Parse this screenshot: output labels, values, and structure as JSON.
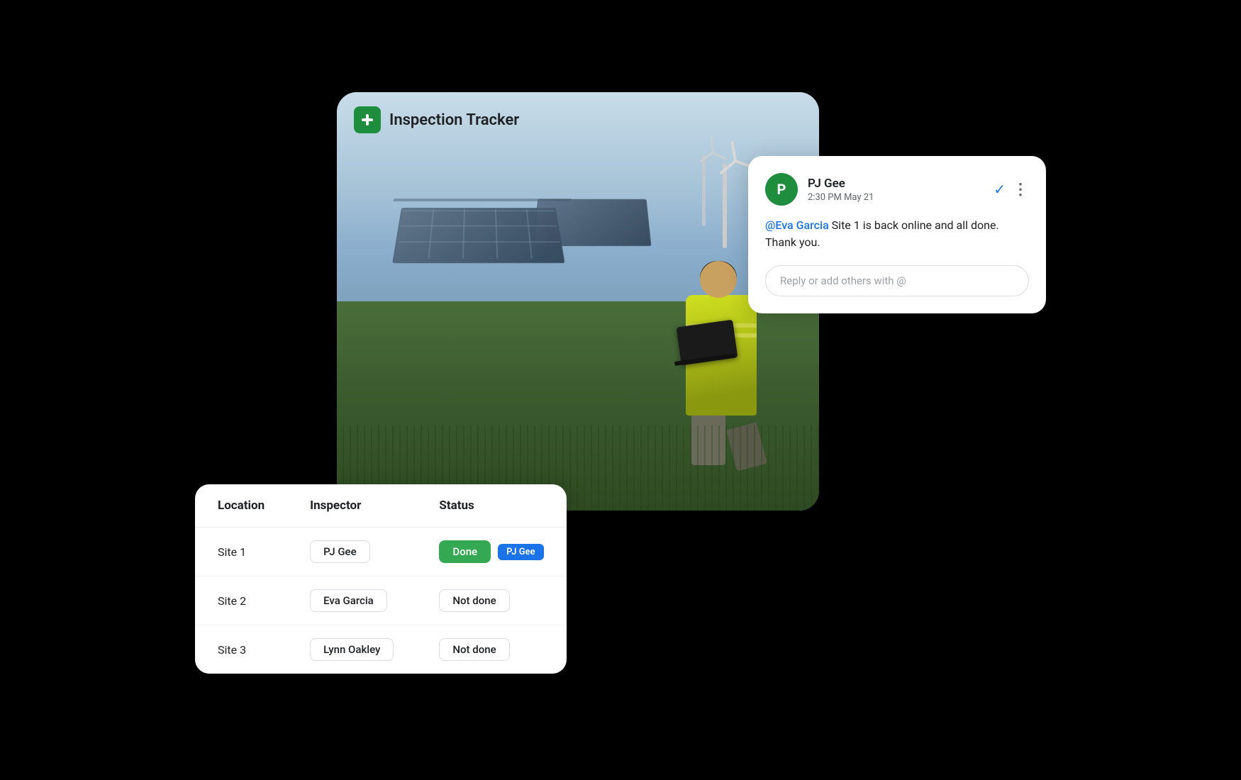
{
  "trackerCard": {
    "title": "Inspection Tracker",
    "iconSymbol": "+"
  },
  "chatCard": {
    "avatar": {
      "initials": "P",
      "color": "#1e8e3e"
    },
    "senderName": "PJ Gee",
    "timestamp": "2:30 PM May 21",
    "message": {
      "mention": "@Eva Garcia",
      "body": " Site 1 is back online and all done. Thank you."
    },
    "replyPlaceholder": "Reply or add others with @",
    "checkIcon": "✓",
    "moreIcon": "⋮"
  },
  "table": {
    "headers": [
      "Location",
      "Inspector",
      "Status"
    ],
    "rows": [
      {
        "location": "Site 1",
        "inspector": "PJ Gee",
        "status": "Done",
        "statusType": "done",
        "tooltip": "PJ Gee"
      },
      {
        "location": "Site 2",
        "inspector": "Eva Garcia",
        "status": "Not done",
        "statusType": "not-done",
        "tooltip": null
      },
      {
        "location": "Site 3",
        "inspector": "Lynn Oakley",
        "status": "Not done",
        "statusType": "not-done",
        "tooltip": null
      }
    ]
  }
}
